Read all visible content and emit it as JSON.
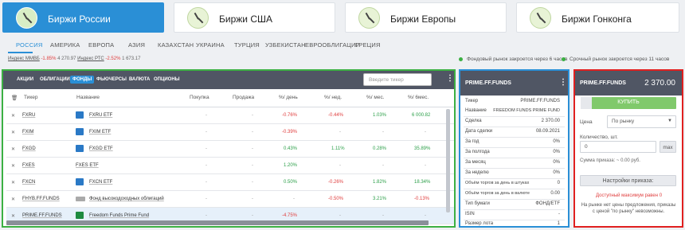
{
  "exchanges": [
    {
      "label": "Биржи России",
      "active": true
    },
    {
      "label": "Биржи США",
      "active": false
    },
    {
      "label": "Биржи Европы",
      "active": false
    },
    {
      "label": "Биржи Гонконга",
      "active": false
    }
  ],
  "country_tabs": [
    "РОССИЯ",
    "АМЕРИКА",
    "ЕВРОПА",
    "АЗИЯ",
    "КАЗАХСТАН",
    "УКРАИНА",
    "ТУРЦИЯ",
    "УЗБЕКИСТАН",
    "ЕВРООБЛИГАЦИИ",
    "ГРЕЦИЯ"
  ],
  "indexes": {
    "mmvb_label": "Индекс ММВБ",
    "mmvb_change": "-1.85%",
    "mmvb_value": "4 270.97",
    "rts_label": "Индекс РТС",
    "rts_change": "-2.52%",
    "rts_value": "1 673.17"
  },
  "market_status": {
    "stock": "Фондовый рынок закроется через 6 часов",
    "futures": "Срочный рынок закроется через 11 часов"
  },
  "asset_tabs": [
    "АКЦИИ",
    "ОБЛИГАЦИИ",
    "ФОНДЫ",
    "ФЬЮЧЕРСЫ",
    "ВАЛЮТА",
    "ОПЦИОНЫ"
  ],
  "active_asset_tab": "ФОНДЫ",
  "search_placeholder": "Введите тикер",
  "columns": {
    "ticker": "Тикер",
    "name": "Название",
    "buy": "Покупка",
    "sell": "Продажа",
    "day": "%/ день",
    "week": "%/ нед.",
    "month": "%/ мес.",
    "six": "%/ 6мес."
  },
  "rows": [
    {
      "ticker": "FXRU",
      "name": "FXRU ETF",
      "buy": "-",
      "sell": "-",
      "day": "-0.76%",
      "week": "-0.44%",
      "month": "1.03%",
      "six": "6 000.82"
    },
    {
      "ticker": "FXIM",
      "name": "FXIM ETF",
      "buy": "-",
      "sell": "-",
      "day": "-0.39%",
      "week": "-",
      "month": "-",
      "six": "-"
    },
    {
      "ticker": "FXGD",
      "name": "FXGD ETF",
      "buy": "-",
      "sell": "-",
      "day": "0.43%",
      "week": "1.11%",
      "month": "0.28%",
      "six": "35.89%"
    },
    {
      "ticker": "FXES",
      "name": "FXES ETF",
      "buy": "-",
      "sell": "-",
      "day": "1.20%",
      "week": "-",
      "month": "-",
      "six": "-"
    },
    {
      "ticker": "FXCN",
      "name": "FXCN ETF",
      "buy": "-",
      "sell": "-",
      "day": "0.50%",
      "week": "-0.26%",
      "month": "1.82%",
      "six": "18.34%"
    },
    {
      "ticker": "FHYB.FF.FUNDS",
      "name": "Фонд высокодоходных облигаций",
      "buy": "-",
      "sell": "-",
      "day": "-",
      "week": "-0.50%",
      "month": "3.21%",
      "six": "-0.13%"
    },
    {
      "ticker": "PRIME.FF.FUNDS",
      "name": "Freedom Funds Prime Fund",
      "buy": "-",
      "sell": "-",
      "day": "-4.75%",
      "week": "-",
      "month": "-",
      "six": "-"
    }
  ],
  "info": {
    "title": "PRIME.FF.FUNDS",
    "fields": [
      {
        "k": "Тикер",
        "v": "PRIME.FF.FUNDS"
      },
      {
        "k": "Название",
        "v": "FREEDOM FUNDS PRIME FUND"
      },
      {
        "k": "Сделка",
        "v": "2 370.00"
      },
      {
        "k": "Дата сделки",
        "v": "08.09.2021"
      },
      {
        "k": "За год",
        "v": "0%"
      },
      {
        "k": "За полгода",
        "v": "0%"
      },
      {
        "k": "За месяц",
        "v": "0%"
      },
      {
        "k": "За неделю",
        "v": "0%"
      },
      {
        "k": "Объём торгов за день в штуках",
        "v": "0"
      },
      {
        "k": "Объём торгов за день в валюте",
        "v": "0.00"
      },
      {
        "k": "Тип бумаги",
        "v": "ФОНД/ETF"
      },
      {
        "k": "ISIN",
        "v": "-"
      },
      {
        "k": "Размер лота",
        "v": "1"
      }
    ]
  },
  "order": {
    "title": "PRIME.FF.FUNDS",
    "price": "2 370.00",
    "buy_label": "КУПИТЬ",
    "price_label": "Цена",
    "price_value": "По рынку",
    "qty_label": "Количество, шт.",
    "qty_value": "0",
    "max_label": "max",
    "sum_text": "Сумма приказа: ~ 0.00 руб.",
    "settings_label": "Настройки приказа:",
    "max_avail": "Доступный максимум равен 0",
    "warning": "На рынке нет цены предложения, приказы с ценой \"по рынку\" невозможны."
  },
  "colors": {
    "accent": "#2a8fd6",
    "header": "#505664",
    "green": "#2c9f49",
    "red": "#e04040",
    "frame_green": "#3cb043",
    "frame_blue": "#2a8fd6",
    "frame_red": "#e02020"
  }
}
